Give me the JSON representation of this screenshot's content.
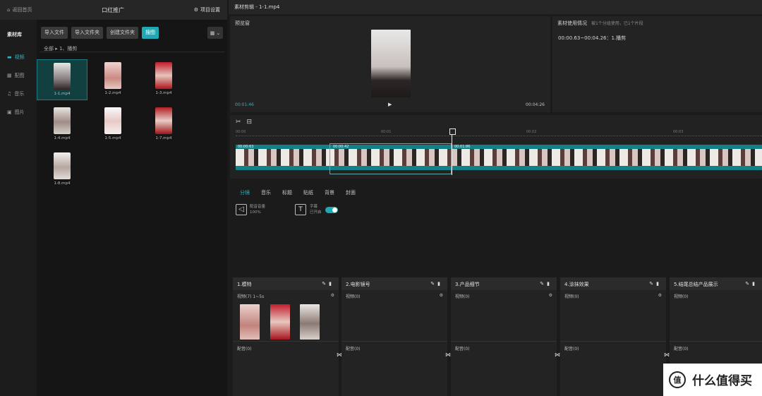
{
  "topbar": {
    "back": "返回首页",
    "project": "口红推广",
    "settings": "项目设置"
  },
  "sidenav": {
    "library": "素材库",
    "items": [
      {
        "label": "视频",
        "icon": "video-icon"
      },
      {
        "label": "配图",
        "icon": "image-icon"
      },
      {
        "label": "音乐",
        "icon": "music-icon"
      },
      {
        "label": "图片",
        "icon": "picture-icon"
      }
    ]
  },
  "toolbar": {
    "buttons": [
      "导入文件",
      "导入文件夹",
      "创建文件夹",
      "搜图"
    ]
  },
  "breadcrumb": "全部 ▸ 1、播剪",
  "files": [
    {
      "name": "1-1.mp4",
      "color": "#c9c9c9"
    },
    {
      "name": "1-2.mp4",
      "color": "#d9a49f"
    },
    {
      "name": "1-3.mp4",
      "color": "#c11d2b"
    },
    {
      "name": "1-4.mp4",
      "color": "#cfcac5"
    },
    {
      "name": "1-5.mp4",
      "color": "#ede9e8"
    },
    {
      "name": "1-7.mp4",
      "color": "#b21e22"
    },
    {
      "name": "1-8.mp4",
      "color": "#e1ddd9"
    }
  ],
  "right": {
    "title": "素材剪辑 - 1-1.mp4"
  },
  "preview": {
    "header": "预览窗",
    "time_current": "00:01:46",
    "time_total": "00:04:26"
  },
  "subtitles": {
    "header": "素材使用情况",
    "hint": "被1个分组使用，已1个片段",
    "line": "00:00.63~00:04.26：1.播剪"
  },
  "ruler": [
    "00:00",
    "00:01",
    "00:02",
    "00:03"
  ],
  "clips": [
    "00:00:63",
    "00:00:42",
    "00:01:86"
  ],
  "tabs": [
    "分镜",
    "音乐",
    "标题",
    "贴纸",
    "背景",
    "封面"
  ],
  "audio": {
    "label": "配音音量",
    "value": "100%"
  },
  "subtitle_toggle": {
    "label": "字幕",
    "state": "已开启"
  },
  "tracks": [
    {
      "title": "1.模特",
      "sub": "视频(7) 1~5s",
      "vo": "配音(0)"
    },
    {
      "title": "2.电影镜号",
      "sub": "视频(0)",
      "vo": "配音(0)"
    },
    {
      "title": "3.产品细节",
      "sub": "视频(0)",
      "vo": "配音(0)"
    },
    {
      "title": "4.涂抹效果",
      "sub": "视频(0)",
      "vo": "配音(0)"
    },
    {
      "title": "5.结尾总结产品展示",
      "sub": "视频(0)",
      "vo": "配音(0)"
    }
  ],
  "watermark": {
    "logo": "值",
    "text": "什么值得买"
  }
}
